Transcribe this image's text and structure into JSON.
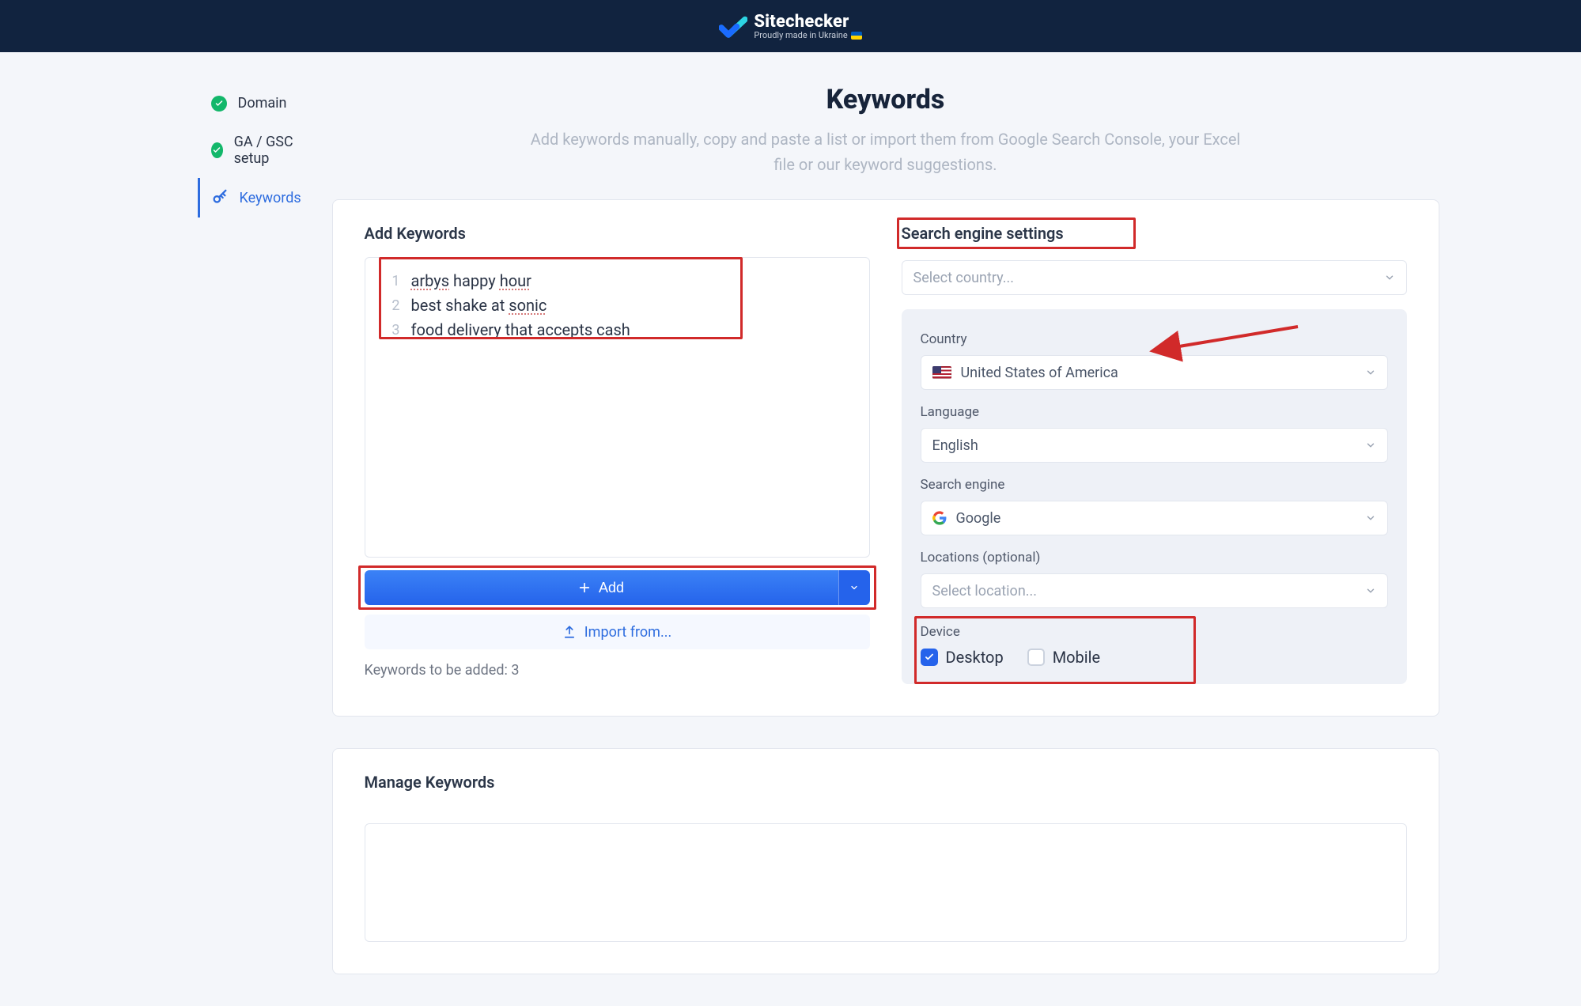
{
  "brand": {
    "name": "Sitechecker",
    "sub": "Proudly made in Ukraine"
  },
  "sidebar": {
    "items": [
      {
        "label": "Domain"
      },
      {
        "label": "GA / GSC setup"
      },
      {
        "label": "Keywords"
      }
    ]
  },
  "hero": {
    "title": "Keywords",
    "desc": "Add keywords manually, copy and paste a list or import them from Google Search Console, your Excel file or our keyword suggestions."
  },
  "addKeywords": {
    "heading": "Add Keywords",
    "lines": [
      {
        "n": "1",
        "text": "arbys happy hour"
      },
      {
        "n": "2",
        "text": "best shake at sonic"
      },
      {
        "n": "3",
        "text": "food delivery that accepts cash"
      }
    ],
    "addLabel": "Add",
    "importLabel": "Import from...",
    "countLabel": "Keywords to be added: 3"
  },
  "settings": {
    "heading": "Search engine settings",
    "selectCountryPlaceholder": "Select country...",
    "countryLabel": "Country",
    "countryValue": "United States of America",
    "languageLabel": "Language",
    "languageValue": "English",
    "engineLabel": "Search engine",
    "engineValue": "Google",
    "locationsLabel": "Locations (optional)",
    "locationsPlaceholder": "Select location...",
    "deviceLabel": "Device",
    "desktop": "Desktop",
    "mobile": "Mobile"
  },
  "manage": {
    "heading": "Manage Keywords"
  }
}
